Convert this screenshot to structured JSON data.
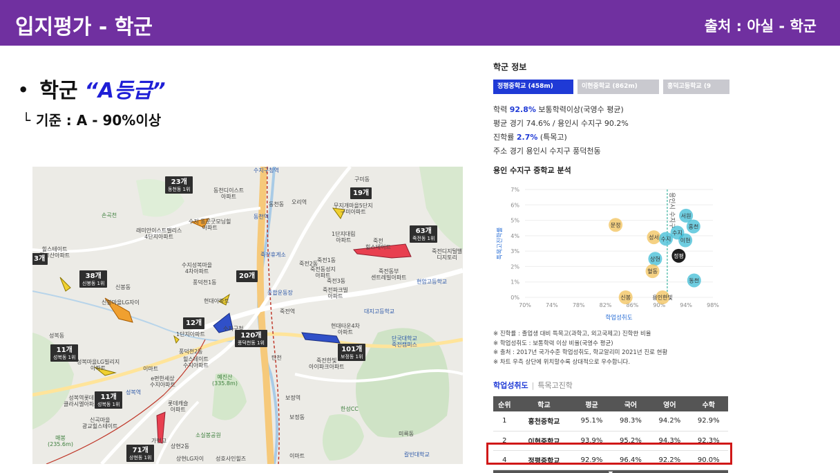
{
  "header": {
    "title": "입지평가 - 학군",
    "source": "출처 : 아실 - 학군",
    "bar_color": "#7030a0"
  },
  "slide": {
    "bullet_dot": "•",
    "bullet_label": "학군",
    "bullet_grade": "“A등급”",
    "criteria_corner": "└",
    "criteria": "기준 : A - 90%이상"
  },
  "map": {
    "labels": {
      "l1": "수지구청역",
      "l2": "동천디이스트\n아파트",
      "l3": "구미동",
      "l4": "오리역",
      "l5": "무지개마을5단지\n구미아파트",
      "l6": "손곡천",
      "l7": "래미안이스트팰리스\n4단지아파트",
      "l8": "수지 동문굿모닝힐\n아파트",
      "l9": "동천역",
      "l10": "1단지대림\n아파트",
      "l11": "죽전\n힐스테이트",
      "l12": "힐스테이트\n광교산아파트",
      "l13": "수지성복마을\n4차아파트",
      "l14": "죽전휴게소",
      "l15": "죽전2동",
      "l16": "죽전1동",
      "l17": "죽전동성지\n아파트",
      "l18": "죽전디지털밸\n디지토리",
      "l19": "풍덕천1동",
      "l20": "죽전3동",
      "l21": "죽전파크빌\n아파트",
      "l22": "죽전동부\n센트레빌아파트",
      "l23": "신봉동",
      "l24": "현대아파트",
      "l25": "종합운동장",
      "l26": "현암고등학교",
      "l27": "신봉마을LG자이",
      "l28": "대지고등학교",
      "l29": "죽전역",
      "l30": "수지구청",
      "l31": "현대타운4차\n아파트",
      "l32": "단국대학교\n죽전캠퍼스",
      "l33": "성복동",
      "l34": "1단지아파트",
      "l35": "성복마을LG빌리지\n아파트",
      "l36": "풍덕천2동",
      "l37": "힐스테이트\n수지아파트",
      "l38": "탄천",
      "l39": "죽전한빛\n아이파크아파트",
      "l40": "e편한세상\n수지아파트",
      "l41": "예진산\n(335.8m)",
      "l42": "이마트",
      "l43": "성복역",
      "l44": "보정역",
      "l45": "성복역롯데\n클라시엘아파트",
      "l46": "롯데캐슬\n아파트",
      "l47": "한성CC",
      "l48": "보정동",
      "l49": "신곡마을\n광교힐스테이트",
      "l50": "소실봉공원",
      "l51": "미륵동",
      "l52": "매봉\n(235.6m)",
      "l53": "상현2동",
      "l54": "상현LG자이",
      "l55": "성호사인힐즈",
      "l56": "칼빈대학교",
      "l57": "이마트",
      "l58": "가현고",
      "l59": "동천동"
    },
    "counts": [
      {
        "n": "23개",
        "d": "동천동 1위"
      },
      {
        "n": "19개",
        "d": ""
      },
      {
        "n": "63개",
        "d": "죽전동 1위"
      },
      {
        "n": "3개",
        "d": ""
      },
      {
        "n": "38개",
        "d": "신봉동 1위"
      },
      {
        "n": "20개",
        "d": ""
      },
      {
        "n": "12개",
        "d": ""
      },
      {
        "n": "120개",
        "d": "풍덕천동 1위"
      },
      {
        "n": "101개",
        "d": "보정동 1위"
      },
      {
        "n": "11개",
        "d": "성복동 1위"
      },
      {
        "n": "11개",
        "d": "성복동 1위"
      },
      {
        "n": "71개",
        "d": "상현동 1위"
      }
    ]
  },
  "panel": {
    "title": "학군 정보",
    "tabs": [
      "정평중학교 (458m)",
      "이현중학교 (862m)",
      "홍덕고등학교 (9"
    ],
    "info": {
      "line1_a": "학력 ",
      "line1_hl": "92.8%",
      "line1_b": " 보통학력이상(국영수 평균)",
      "line2": "평균 경기 74.6% / 용인시 수지구 90.2%",
      "line3_a": "진학률 ",
      "line3_hl": "2.7%",
      "line3_b": " (특목고)",
      "line4": "주소 경기 용인시 수지구 풍덕천동"
    },
    "chart_title": "용인 수지구 중학교 분석",
    "notes": [
      "※ 진학률 : 졸업생 대비 특목고(과학고, 외고국제고) 진학한 비율",
      "※ 학업성취도 : 보통학력 이상 비율(국영수 평균)",
      "※ 출처 : 2017년 국가수준 학업성취도, 학교알리미 2021년 진로 현황",
      "※ 차트 우측 상단에 위치할수록 상대적으로 우수합니다."
    ],
    "subtab_on": "학업성취도",
    "subtab_sep": "|",
    "subtab_off": "특목고진학",
    "table_headers": [
      "순위",
      "학교",
      "평균",
      "국어",
      "영어",
      "수학"
    ],
    "table_rows": [
      [
        "1",
        "홍천중학교",
        "95.1%",
        "98.3%",
        "94.2%",
        "92.9%"
      ],
      [
        "2",
        "이현중학교",
        "93.9%",
        "95.2%",
        "94.3%",
        "92.3%"
      ],
      [
        "4",
        "정평중학교",
        "92.9%",
        "96.4%",
        "92.2%",
        "90.0%"
      ]
    ],
    "table_foot": "▼",
    "highlight_color": "#d01818"
  },
  "chart_data": {
    "type": "scatter",
    "title": "용인 수지구 중학교 분석",
    "xlabel": "학업성취도",
    "ylabel": "특목고진학률",
    "x_ticks": [
      "70%",
      "74%",
      "78%",
      "82%",
      "86%",
      "90%",
      "94%",
      "98%"
    ],
    "y_ticks": [
      "0%",
      "1%",
      "2%",
      "3%",
      "4%",
      "5%",
      "6%",
      "7%"
    ],
    "xlim": [
      70,
      98
    ],
    "ylim": [
      0,
      7
    ],
    "reference_line_label": "용인시 수지구",
    "reference_x": 91.2,
    "points": [
      {
        "label": "문정",
        "x": 83.5,
        "y": 4.7,
        "color": "#f2c25a"
      },
      {
        "label": "성서",
        "x": 89.2,
        "y": 3.9,
        "color": "#f2c25a"
      },
      {
        "label": "정평",
        "x": 92.9,
        "y": 2.7,
        "color": "#111111"
      },
      {
        "label": "상현",
        "x": 89.4,
        "y": 2.5,
        "color": "#3fbcd6"
      },
      {
        "label": "혈동",
        "x": 89.0,
        "y": 1.7,
        "color": "#f2c25a"
      },
      {
        "label": "서원",
        "x": 94.0,
        "y": 5.3,
        "color": "#3fbcd6"
      },
      {
        "label": "홍천",
        "x": 95.1,
        "y": 4.6,
        "color": "#3fbcd6"
      },
      {
        "label": "이현",
        "x": 93.9,
        "y": 3.7,
        "color": "#3fbcd6"
      },
      {
        "label": "수지",
        "x": 91.0,
        "y": 3.8,
        "color": "#3fbcd6"
      },
      {
        "label": "수지",
        "x": 92.7,
        "y": 4.2,
        "color": "#3fbcd6"
      },
      {
        "label": "동천",
        "x": 95.2,
        "y": 1.1,
        "color": "#3fbcd6"
      },
      {
        "label": "신봉",
        "x": 85.0,
        "y": 0.0,
        "color": "#f2c25a"
      },
      {
        "label": "용인한빛",
        "x": 90.5,
        "y": 0.0,
        "color": "#f2c25a"
      }
    ]
  }
}
